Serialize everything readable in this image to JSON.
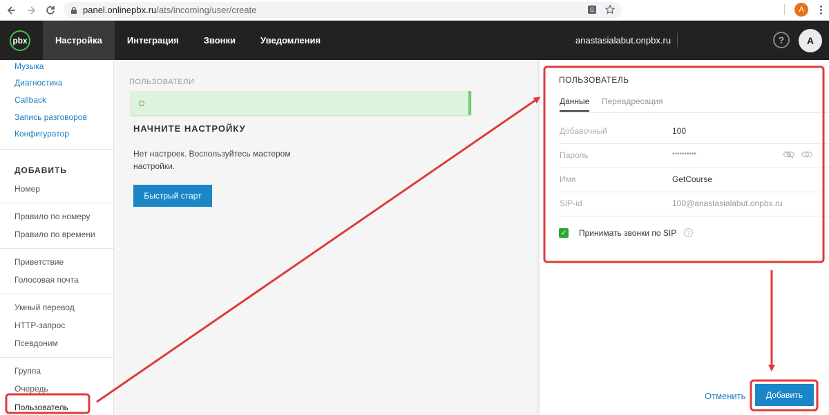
{
  "browser": {
    "url_host": "panel.onlinepbx.ru",
    "url_path": "/ats/incoming/user/create",
    "profile_initial": "A"
  },
  "header": {
    "logo": "pbx",
    "tabs": [
      {
        "label": "Настройка",
        "active": true
      },
      {
        "label": "Интеграция",
        "active": false
      },
      {
        "label": "Звонки",
        "active": false
      },
      {
        "label": "Уведомления",
        "active": false
      }
    ],
    "domain": "anastasialabut.onpbx.ru",
    "help": "?",
    "avatar": "A"
  },
  "sidebar": {
    "top_links": [
      "Музыка",
      "Диагностика",
      "Callback",
      "Запись разговоров",
      "Конфигуратор"
    ],
    "add_heading": "ДОБАВИТЬ",
    "items": [
      "Номер",
      "Правило по номеру",
      "Правило по времени",
      "Приветствие",
      "Голосовая почта",
      "Умный перевод",
      "HTTP-запрос",
      "Псевдоним",
      "Группа",
      "Очередь",
      "Пользователь"
    ]
  },
  "main": {
    "section_label": "ПОЛЬЗОВАТЕЛИ",
    "title": "НАЧНИТЕ НАСТРОЙКУ",
    "text": "Нет настроек. Воспользуйтесь мастером настройки.",
    "quick_start": "Быстрый старт"
  },
  "panel": {
    "title": "ПОЛЬЗОВАТЕЛЬ",
    "tabs": [
      "Данные",
      "Переадресация"
    ],
    "fields": {
      "ext_label": "Добавочный",
      "ext_value": "100",
      "password_label": "Пароль",
      "password_value": "••••••••••",
      "name_label": "Имя",
      "name_value": "GetCourse",
      "sip_label": "SIP-id",
      "sip_value": "100@anastasialabut.onpbx.ru"
    },
    "accept_sip_label": "Принимать звонки по SIP",
    "accept_sip_checked": true,
    "cancel": "Отменить",
    "add": "Добавить"
  },
  "colors": {
    "accent": "#1a86c7",
    "header_bg": "#222222",
    "annotation": "#e03a3a",
    "check": "#2fa82f"
  }
}
